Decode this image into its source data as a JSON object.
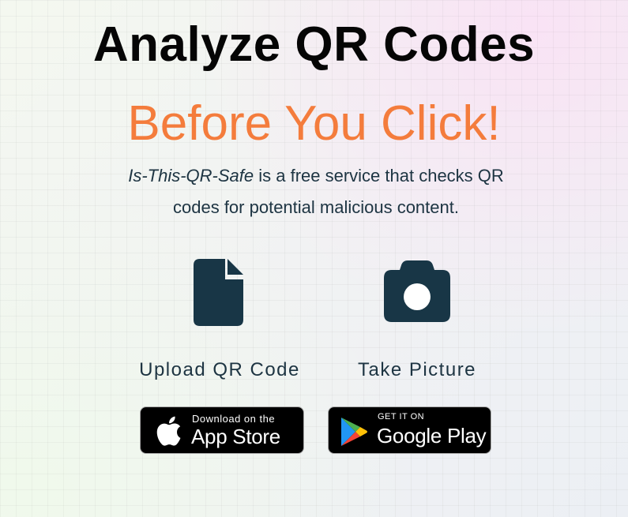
{
  "hero": {
    "headline": "Analyze QR Codes",
    "subheadline": "Before You Click!",
    "description_brand": "Is-This-QR-Safe",
    "description_rest": " is a free service that checks QR codes for potential malicious content."
  },
  "actions": [
    {
      "label": "Upload QR Code",
      "icon": "file-icon"
    },
    {
      "label": "Take Picture",
      "icon": "camera-icon"
    }
  ],
  "badges": {
    "app_store": {
      "small": "Download on the",
      "big": "App Store",
      "icon": "apple-icon"
    },
    "google_play": {
      "small": "GET IT ON",
      "big": "Google Play",
      "icon": "google-play-icon"
    }
  },
  "colors": {
    "accent": "#f47c3c",
    "icon": "#183646",
    "text": "#1d3442",
    "heading": "#050505"
  }
}
